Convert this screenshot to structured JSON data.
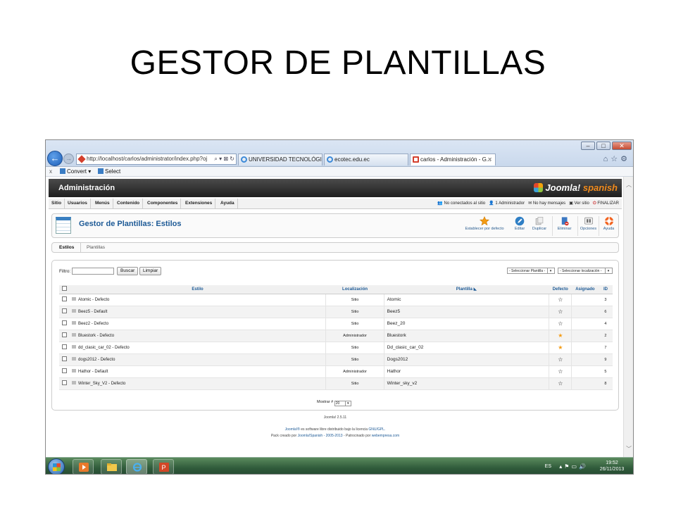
{
  "slide": {
    "title": "GESTOR DE PLANTILLAS"
  },
  "browser": {
    "address": "http://localhost/carlos/administrator/index.php?oj",
    "address_host": "localhost",
    "tabs": [
      {
        "label": "UNIVERSIDAD TECNOLÓGICA ..."
      },
      {
        "label": "ecotec.edu.ec"
      },
      {
        "label": "carlos - Administración - G..."
      }
    ],
    "cmd_convert": "Convert",
    "cmd_select": "Select"
  },
  "admin": {
    "brand": "Administración",
    "logo_text": "Joomla!",
    "logo_sub": "spanish",
    "menu": [
      "Sitio",
      "Usuarios",
      "Menús",
      "Contenido",
      "Componentes",
      "Extensiones",
      "Ayuda"
    ],
    "status": {
      "no_conectados": "No conectados al sitio",
      "administradores": "1 Administrador",
      "mensajes": "No hay mensajes",
      "ver_sitio": "Ver sitio",
      "finalizar": "FINALIZAR"
    },
    "page_title": "Gestor de Plantillas: Estilos",
    "toolbar": {
      "default": "Establecer por defecto",
      "edit": "Editar",
      "duplicate": "Duplicar",
      "delete": "Eliminar",
      "options": "Opciones",
      "help": "Ayuda"
    },
    "subnav": {
      "styles": "Estilos",
      "templates": "Plantillas"
    },
    "filter": {
      "label": "Filtro:",
      "value": "",
      "search": "Buscar",
      "clear": "Limpiar",
      "select_template": "- Seleccionar Plantilla -",
      "select_location": "- Seleccionar localización -"
    },
    "table": {
      "headers": {
        "style": "Estilo",
        "location": "Localización",
        "template": "Plantilla",
        "default": "Defecto",
        "assigned": "Asignado",
        "id": "ID"
      },
      "rows": [
        {
          "style": "Atomic - Defecto",
          "location": "Sitio",
          "template": "Atomic",
          "default": false,
          "id": "3"
        },
        {
          "style": "Beez5 - Default",
          "location": "Sitio",
          "template": "Beez5",
          "default": false,
          "id": "6"
        },
        {
          "style": "Beez2 - Defecto",
          "location": "Sitio",
          "template": "Beez_20",
          "default": false,
          "id": "4"
        },
        {
          "style": "Bluestork - Defecto",
          "location": "Administrador",
          "template": "Bluestork",
          "default": true,
          "id": "2"
        },
        {
          "style": "dd_clasic_car_02 - Defecto",
          "location": "Sitio",
          "template": "Dd_clasic_car_02",
          "default": true,
          "id": "7"
        },
        {
          "style": "dogs2012 - Defecto",
          "location": "Sitio",
          "template": "Dogs2012",
          "default": false,
          "id": "9"
        },
        {
          "style": "Hathor - Default",
          "location": "Administrador",
          "template": "Hathor",
          "default": false,
          "id": "5"
        },
        {
          "style": "Winter_Sky_V2 - Defecto",
          "location": "Sitio",
          "template": "Winter_sky_v2",
          "default": false,
          "id": "8"
        }
      ]
    },
    "pager": {
      "label": "Mostrar #",
      "value": "20"
    },
    "footer": {
      "version": "Joomla! 2.5.11",
      "license_a": "Joomla!®",
      "license_b": "es software libre distribuido bajo la licencia",
      "license_c": "GNU/GPL.",
      "pack_a": "Pack creado por",
      "pack_b": "Joomla!Spanish - 2005-2013",
      "pack_c": "- Patrocinado por",
      "pack_d": "webempresa.com"
    }
  },
  "taskbar": {
    "lang": "ES",
    "time": "19:52",
    "date": "26/11/2013"
  },
  "colors": {
    "accent": "#1d5a96",
    "star_on": "#f49b12",
    "admin_bar": "#2a2a2a"
  }
}
